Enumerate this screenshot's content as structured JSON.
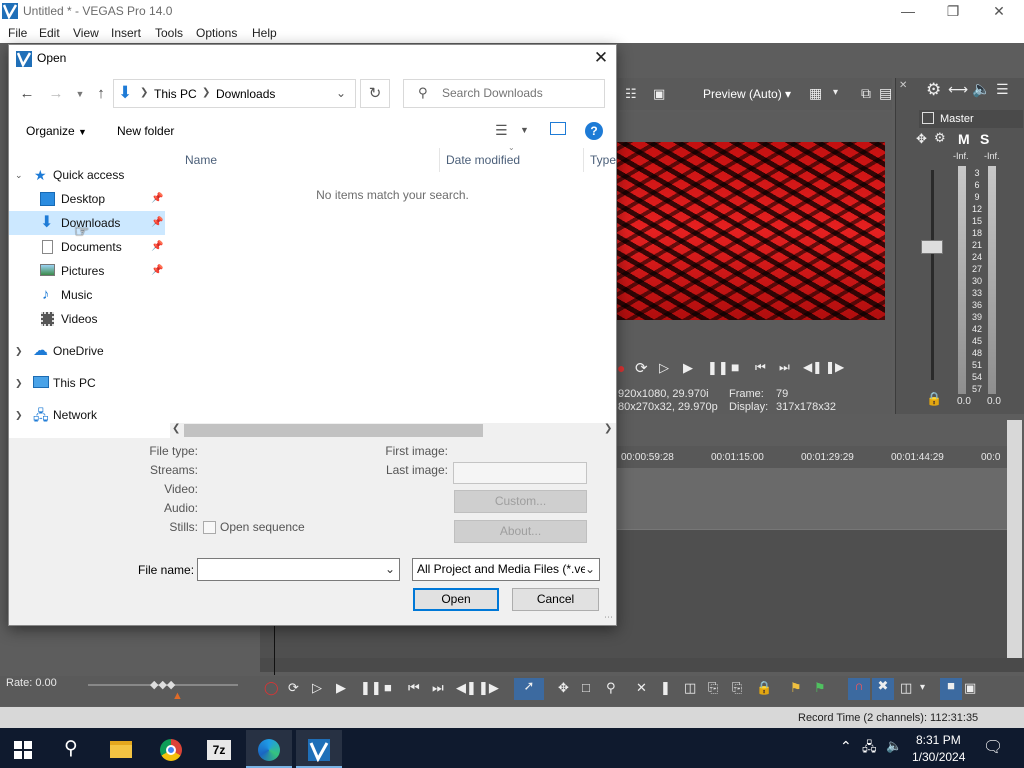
{
  "app": {
    "title": "Untitled * - VEGAS Pro 14.0",
    "menu": [
      "File",
      "Edit",
      "View",
      "Insert",
      "Tools",
      "Options",
      "Help"
    ],
    "preview_mode": "Preview (Auto)",
    "mixer_label": "Master",
    "mixer_buttons": [
      "M",
      "S"
    ],
    "mixer_inf": "-Inf.",
    "vu_scale": [
      "3",
      "6",
      "9",
      "12",
      "15",
      "18",
      "21",
      "24",
      "27",
      "30",
      "33",
      "36",
      "39",
      "42",
      "45",
      "48",
      "51",
      "54",
      "57"
    ],
    "mixer_value_left": "0.0",
    "mixer_value_right": "0.0",
    "preview_info_line1_left": "920x1080, 29.970i",
    "preview_info_line1_right": "Frame:",
    "preview_frame": "79",
    "preview_info_line2_left": "80x270x32, 29.970p",
    "preview_info_line2_right": "Display:",
    "preview_display": "317x178x32",
    "ruler_ticks": [
      "00:00:59:28",
      "00:01:15:00",
      "00:01:29:29",
      "00:01:44:29",
      "00:0"
    ],
    "rate": "Rate: 0.00",
    "record_time": "Record Time (2 channels): 112:31:35"
  },
  "dialog": {
    "title": "Open",
    "breadcrumb": [
      "This PC",
      "Downloads"
    ],
    "search_placeholder": "Search Downloads",
    "organize": "Organize",
    "new_folder": "New folder",
    "nav": {
      "quick_access": "Quick access",
      "quick_items": [
        {
          "label": "Desktop",
          "icon": "desktop-icon",
          "pinned": true
        },
        {
          "label": "Downloads",
          "icon": "downloads-icon",
          "pinned": true,
          "selected": true
        },
        {
          "label": "Documents",
          "icon": "documents-icon",
          "pinned": true
        },
        {
          "label": "Pictures",
          "icon": "pictures-icon",
          "pinned": true
        },
        {
          "label": "Music",
          "icon": "music-icon",
          "pinned": false
        },
        {
          "label": "Videos",
          "icon": "videos-icon",
          "pinned": false
        }
      ],
      "onedrive": "OneDrive",
      "this_pc": "This PC",
      "network": "Network"
    },
    "columns": [
      "Name",
      "Date modified",
      "Type"
    ],
    "empty_message": "No items match your search.",
    "info": {
      "file_type": "File type:",
      "streams": "Streams:",
      "video": "Video:",
      "audio": "Audio:",
      "stills": "Stills:",
      "open_sequence": "Open sequence",
      "first_image": "First image:",
      "last_image": "Last image:",
      "custom": "Custom...",
      "about": "About..."
    },
    "file_name_label": "File name:",
    "file_name_value": "",
    "file_type_filter": "All Project and Media Files (*.ve",
    "open_button": "Open",
    "cancel_button": "Cancel"
  },
  "taskbar": {
    "time": "8:31 PM",
    "date": "1/30/2024",
    "apps": [
      "start-icon",
      "search-icon",
      "file-explorer-icon",
      "chrome-icon",
      "7zip-icon",
      "edge-icon",
      "vegas-icon"
    ],
    "sevenzip_label": "7z"
  },
  "colors": {
    "accent": "#0078d7",
    "selection": "#cce8ff",
    "taskbar": "#0f1a2e"
  }
}
